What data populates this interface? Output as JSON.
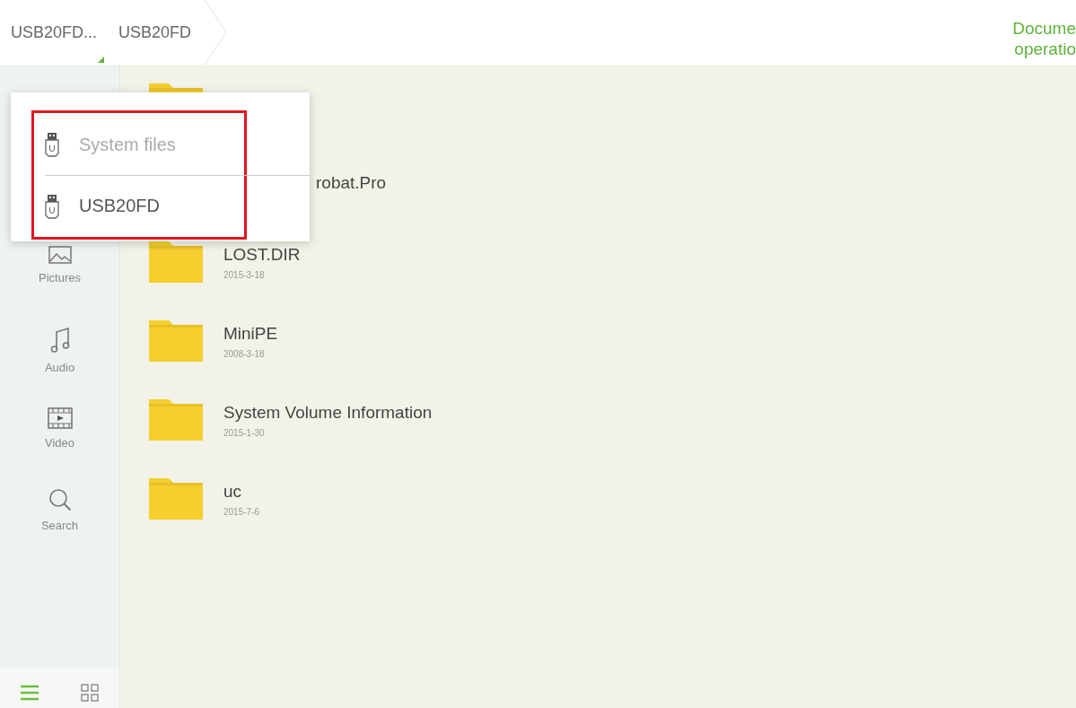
{
  "breadcrumb": [
    {
      "label": "USB20FD...",
      "dropdown": true
    },
    {
      "label": "USB20FD",
      "dropdown": false
    }
  ],
  "top_right": {
    "lines": [
      "Docume",
      "operatio"
    ]
  },
  "sidebar": {
    "items": [
      {
        "label": "Pictures",
        "kind": "picture"
      },
      {
        "label": "Audio",
        "kind": "audio"
      },
      {
        "label": "Video",
        "kind": "video"
      },
      {
        "label": "Search",
        "kind": "search"
      }
    ]
  },
  "view_toggle": [
    {
      "kind": "list",
      "selected": true
    },
    {
      "kind": "grid",
      "selected": false
    }
  ],
  "files": [
    {
      "kind": "folder"
    },
    {
      "name": "robat.Pro",
      "kind": "partial"
    },
    {
      "name": "LOST.DIR",
      "date": "2015-3-18",
      "kind": "folder"
    },
    {
      "name": "MiniPE",
      "date": "2008-3-18",
      "kind": "folder"
    },
    {
      "name": "System Volume Information",
      "date": "2015-1-30",
      "kind": "folder"
    },
    {
      "name": "uc",
      "date": "2015-7-6",
      "kind": "folder"
    }
  ],
  "storage_menu": {
    "items": [
      {
        "label": "System files",
        "disabled": true
      },
      {
        "label": "USB20FD",
        "disabled": false
      }
    ]
  }
}
